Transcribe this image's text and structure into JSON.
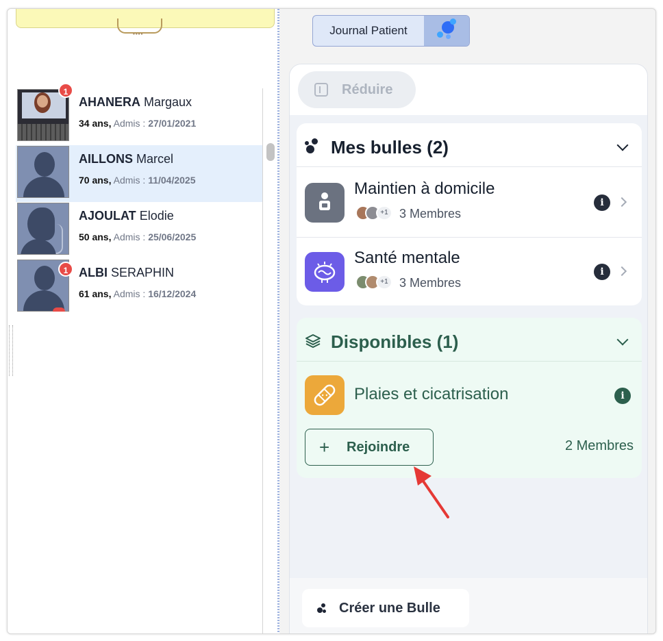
{
  "journal": {
    "label": "Journal Patient",
    "icon": "bubbles-icon"
  },
  "panel": {
    "reduce_label": "Réduire",
    "mes_bulles": {
      "title": "Mes bulles (2)",
      "items": [
        {
          "name": "Maintien à domicile",
          "members": "3 Membres",
          "more": "+1",
          "icon_color": "#6b7280"
        },
        {
          "name": "Santé mentale",
          "members": "3 Membres",
          "more": "+1",
          "icon_color": "#6c5ce7"
        }
      ]
    },
    "disponibles": {
      "title": "Disponibles (1)",
      "item": {
        "name": "Plaies et cicatrisation",
        "members": "2 Membres",
        "icon_color": "#eca83a"
      },
      "join_label": "Rejoindre",
      "join_plus": "+"
    },
    "create_label": "Créer une Bulle"
  },
  "patients": [
    {
      "last": "AHANERA",
      "first": "Margaux",
      "age": "34 ans,",
      "admis_label": "Admis :",
      "date": "27/01/2021",
      "badge": "1"
    },
    {
      "last": "AILLONS",
      "first": "Marcel",
      "age": "70 ans,",
      "admis_label": "Admis :",
      "date": "11/04/2025",
      "badge": ""
    },
    {
      "last": "AJOULAT",
      "first": "Elodie",
      "age": "50 ans,",
      "admis_label": "Admis :",
      "date": "25/06/2025",
      "badge": ""
    },
    {
      "last": "ALBI",
      "first": "SERAPHIN",
      "age": "61 ans,",
      "admis_label": "Admis :",
      "date": "16/12/2024",
      "badge": "1"
    }
  ],
  "colors": {
    "accent_green": "#2c5f4d",
    "badge_red": "#e84b47",
    "arrow_red": "#e53935",
    "selected_row": "#e4effc"
  }
}
